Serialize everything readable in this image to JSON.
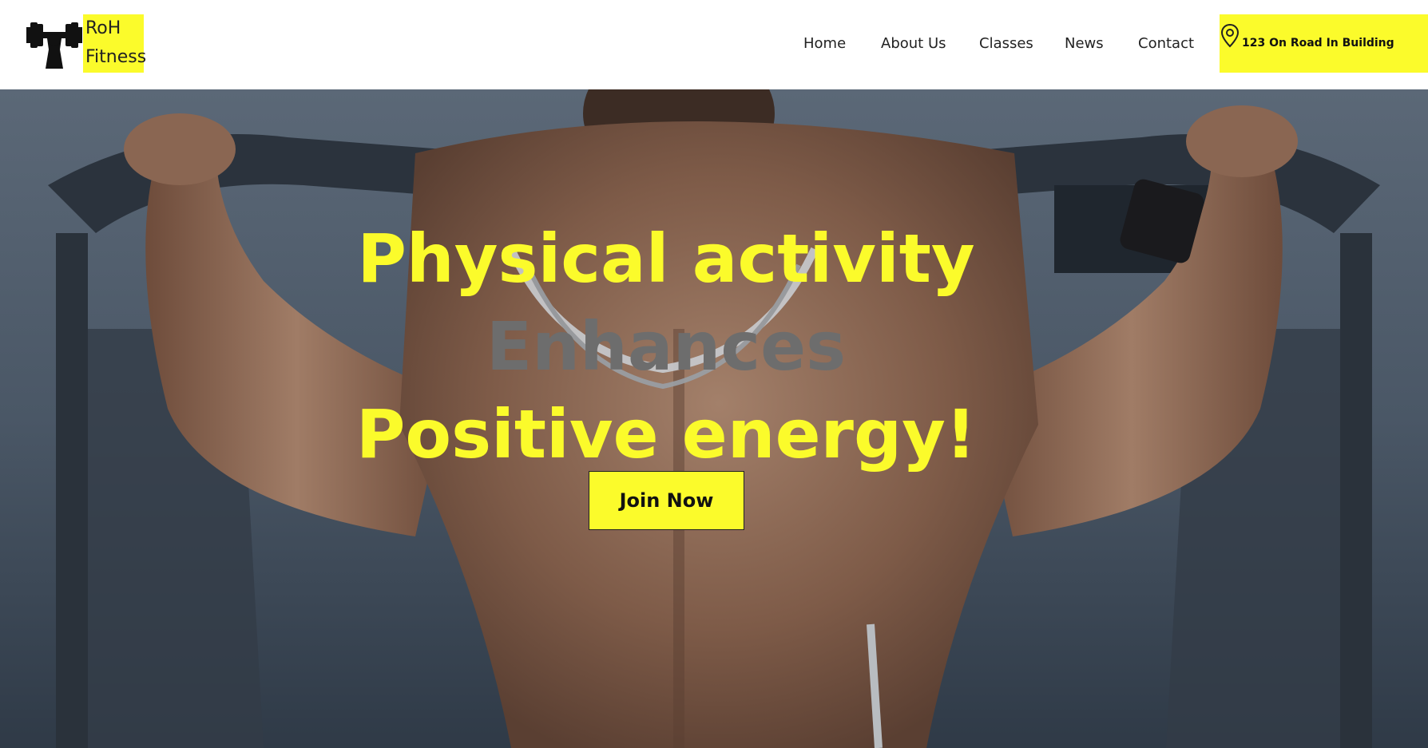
{
  "brand": {
    "logo_icon": "dumbbell-icon",
    "name_line1": "RoH",
    "name_line2": "Fitness"
  },
  "nav": {
    "items": [
      {
        "label": "Home"
      },
      {
        "label": "About Us"
      },
      {
        "label": "Classes"
      },
      {
        "label": "News"
      },
      {
        "label": "Contact"
      }
    ]
  },
  "address": {
    "icon": "map-pin-icon",
    "text": "123 On Road In Building"
  },
  "hero": {
    "headline_line1": "Physical activity",
    "headline_line2": "Enhances",
    "headline_line3": "Positive energy!",
    "cta_label": "Join Now"
  },
  "colors": {
    "accent": "#fbfb2b",
    "headline_secondary": "#6d6d6d",
    "text": "#222222"
  }
}
